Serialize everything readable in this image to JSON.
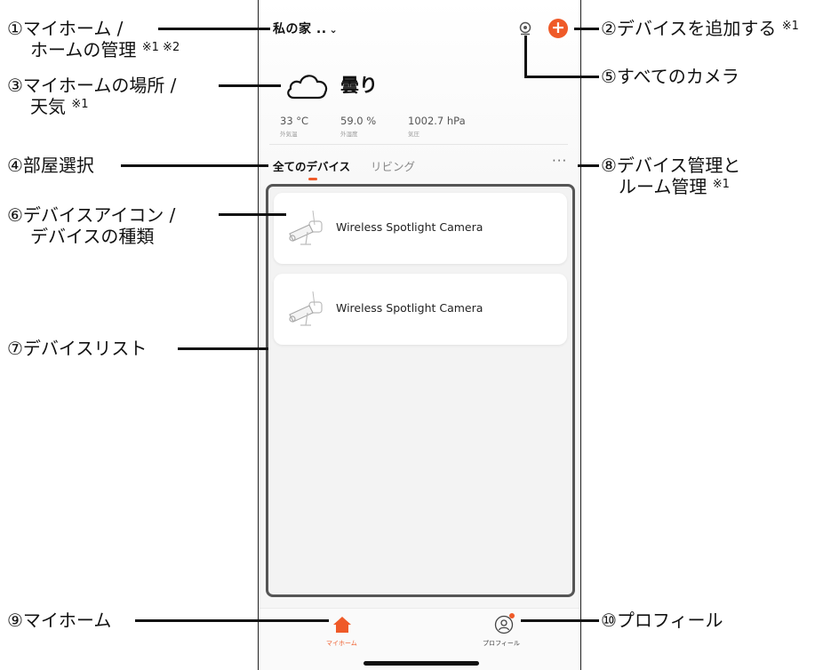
{
  "app": {
    "home_selector": "私の家 ..",
    "add_button_symbol": "+",
    "weather": {
      "condition": "曇り",
      "stats": [
        {
          "value": "33 °C",
          "label": "外気温"
        },
        {
          "value": "59.0 %",
          "label": "外湿度"
        },
        {
          "value": "1002.7 hPa",
          "label": "気圧"
        }
      ]
    },
    "room_tabs": [
      {
        "label": "全てのデバイス",
        "selected": true
      },
      {
        "label": "リビング",
        "selected": false
      }
    ],
    "more_label": "···",
    "devices": [
      {
        "name": "Wireless Spotlight Camera",
        "icon": "camera-icon"
      },
      {
        "name": "Wireless Spotlight Camera",
        "icon": "camera-icon"
      }
    ],
    "bottom_tabs": [
      {
        "label": "マイホーム",
        "icon": "home-icon",
        "active": true
      },
      {
        "label": "プロフィール",
        "icon": "profile-icon",
        "active": false
      }
    ],
    "accent_color": "#ef5a28"
  },
  "annotations": {
    "a1_line1": "①マイホーム /",
    "a1_line2": "ホームの管理",
    "a1_note": "※1 ※2",
    "a2": "②デバイスを追加する",
    "a2_note": "※1",
    "a3_line1": "③マイホームの場所 /",
    "a3_line2": "天気",
    "a3_note": "※1",
    "a4": "④部屋選択",
    "a5": "⑤すべてのカメラ",
    "a6_line1": "⑥デバイスアイコン /",
    "a6_line2": "デバイスの種類",
    "a7": "⑦デバイスリスト",
    "a8_line1": "⑧デバイス管理と",
    "a8_line2": "ルーム管理",
    "a8_note": "※1",
    "a9": "⑨マイホーム",
    "a10": "⑩プロフィール"
  }
}
